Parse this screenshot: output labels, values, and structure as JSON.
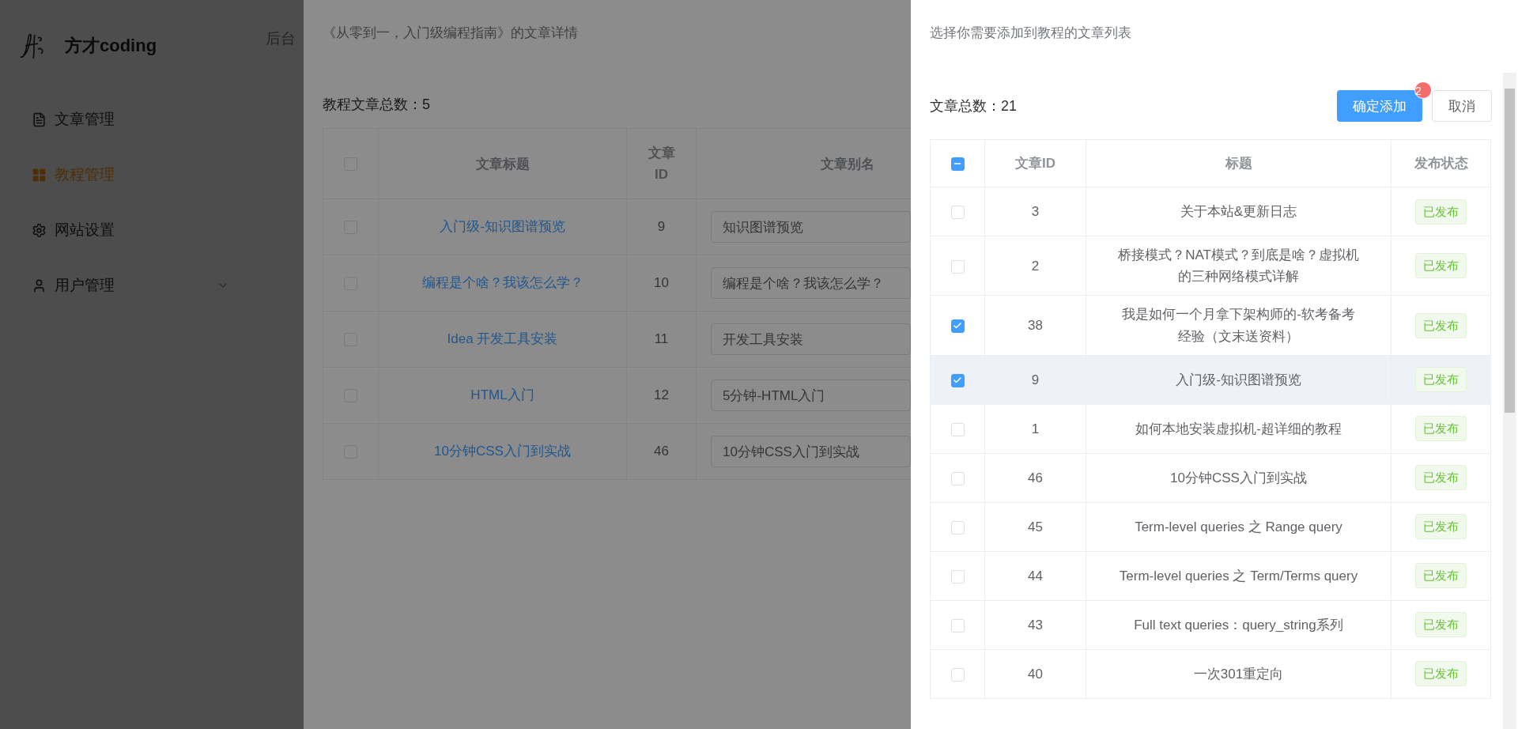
{
  "sidebar": {
    "brand": "方才coding",
    "items": [
      {
        "label": "文章管理",
        "selected": false,
        "kind": "item"
      },
      {
        "label": "教程管理",
        "selected": true,
        "kind": "item"
      },
      {
        "label": "网站设置",
        "selected": false,
        "kind": "item"
      },
      {
        "label": "用户管理",
        "selected": false,
        "kind": "submenu",
        "expanded": false
      }
    ]
  },
  "header": {
    "title": "后台"
  },
  "detail_drawer": {
    "title": "《从零到一，入门级编程指南》的文章详情",
    "count": "教程文章总数：5",
    "select_all_checked": false,
    "columns": [
      "文章标题",
      "文章ID",
      "文章别名"
    ],
    "rows": [
      {
        "title": "入门级-知识图谱预览",
        "id": "9",
        "alias": "知识图谱预览",
        "checked": false
      },
      {
        "title": "编程是个啥？我该怎么学？",
        "id": "10",
        "alias": "编程是个啥？我该怎么学？",
        "checked": false
      },
      {
        "title": "Idea 开发工具安装",
        "id": "11",
        "alias": "开发工具安装",
        "checked": false
      },
      {
        "title": "HTML入门",
        "id": "12",
        "alias": "5分钟-HTML入门",
        "checked": false
      },
      {
        "title": "10分钟CSS入门到实战",
        "id": "46",
        "alias": "10分钟CSS入门到实战",
        "checked": false
      }
    ]
  },
  "selector": {
    "title": "选择你需要添加到教程的文章列表",
    "count": "文章总数：21",
    "confirm_button": "确定添加",
    "badge": "2",
    "cancel_button": "取消",
    "select_all": {
      "indeterminate": true
    },
    "columns": [
      "文章ID",
      "标题",
      "发布状态"
    ],
    "rows": [
      {
        "id": "3",
        "title": "关于本站&更新日志",
        "status": "已发布",
        "checked": false,
        "highlighted": false
      },
      {
        "id": "2",
        "title": "桥接模式？NAT模式？到底是啥？虚拟机的三种网络模式详解",
        "status": "已发布",
        "checked": false,
        "highlighted": false
      },
      {
        "id": "38",
        "title": "我是如何一个月拿下架构师的-软考备考经验（文末送资料）",
        "status": "已发布",
        "checked": true,
        "highlighted": false
      },
      {
        "id": "9",
        "title": "入门级-知识图谱预览",
        "status": "已发布",
        "checked": true,
        "highlighted": true
      },
      {
        "id": "1",
        "title": "如何本地安装虚拟机-超详细的教程",
        "status": "已发布",
        "checked": false,
        "highlighted": false
      },
      {
        "id": "46",
        "title": "10分钟CSS入门到实战",
        "status": "已发布",
        "checked": false,
        "highlighted": false
      },
      {
        "id": "45",
        "title": "Term-level queries 之 Range query",
        "status": "已发布",
        "checked": false,
        "highlighted": false
      },
      {
        "id": "44",
        "title": "Term-level queries 之 Term/Terms query",
        "status": "已发布",
        "checked": false,
        "highlighted": false
      },
      {
        "id": "43",
        "title": "Full text queries：query_string系列",
        "status": "已发布",
        "checked": false,
        "highlighted": false
      },
      {
        "id": "40",
        "title": "一次301重定向",
        "status": "已发布",
        "checked": false,
        "highlighted": false
      }
    ]
  }
}
